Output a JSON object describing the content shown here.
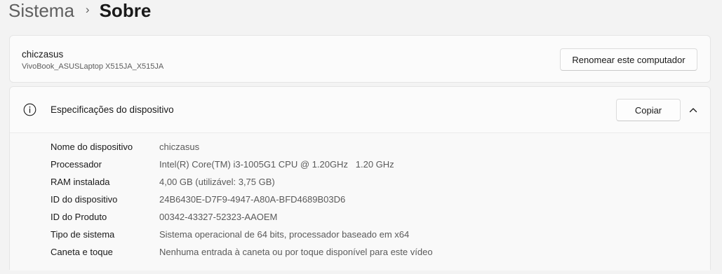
{
  "breadcrumb": {
    "parent": "Sistema",
    "separator": "›",
    "current": "Sobre"
  },
  "device": {
    "name": "chiczasus",
    "model": "VivoBook_ASUSLaptop X515JA_X515JA",
    "rename_label": "Renomear este computador"
  },
  "specs": {
    "title": "Especificações do dispositivo",
    "copy_label": "Copiar",
    "icon": "info-icon",
    "collapse_icon": "chevron-up-icon",
    "rows": [
      {
        "label": "Nome do dispositivo",
        "value": "chiczasus"
      },
      {
        "label": "Processador",
        "value": "Intel(R) Core(TM) i3-1005G1 CPU @ 1.20GHz   1.20 GHz"
      },
      {
        "label": "RAM instalada",
        "value": "4,00 GB (utilizável: 3,75 GB)"
      },
      {
        "label": "ID do dispositivo",
        "value": "24B6430E-D7F9-4947-A80A-BFD4689B03D6"
      },
      {
        "label": "ID do Produto",
        "value": "00342-43327-52323-AAOEM"
      },
      {
        "label": "Tipo de sistema",
        "value": "Sistema operacional de 64 bits, processador baseado em x64"
      },
      {
        "label": "Caneta e toque",
        "value": "Nenhuma entrada à caneta ou por toque disponível para este vídeo"
      }
    ]
  },
  "colors": {
    "background": "#f3f3f3",
    "card": "#fbfbfb",
    "text_primary": "#1a1a1a",
    "text_secondary": "#5a5a5a"
  }
}
